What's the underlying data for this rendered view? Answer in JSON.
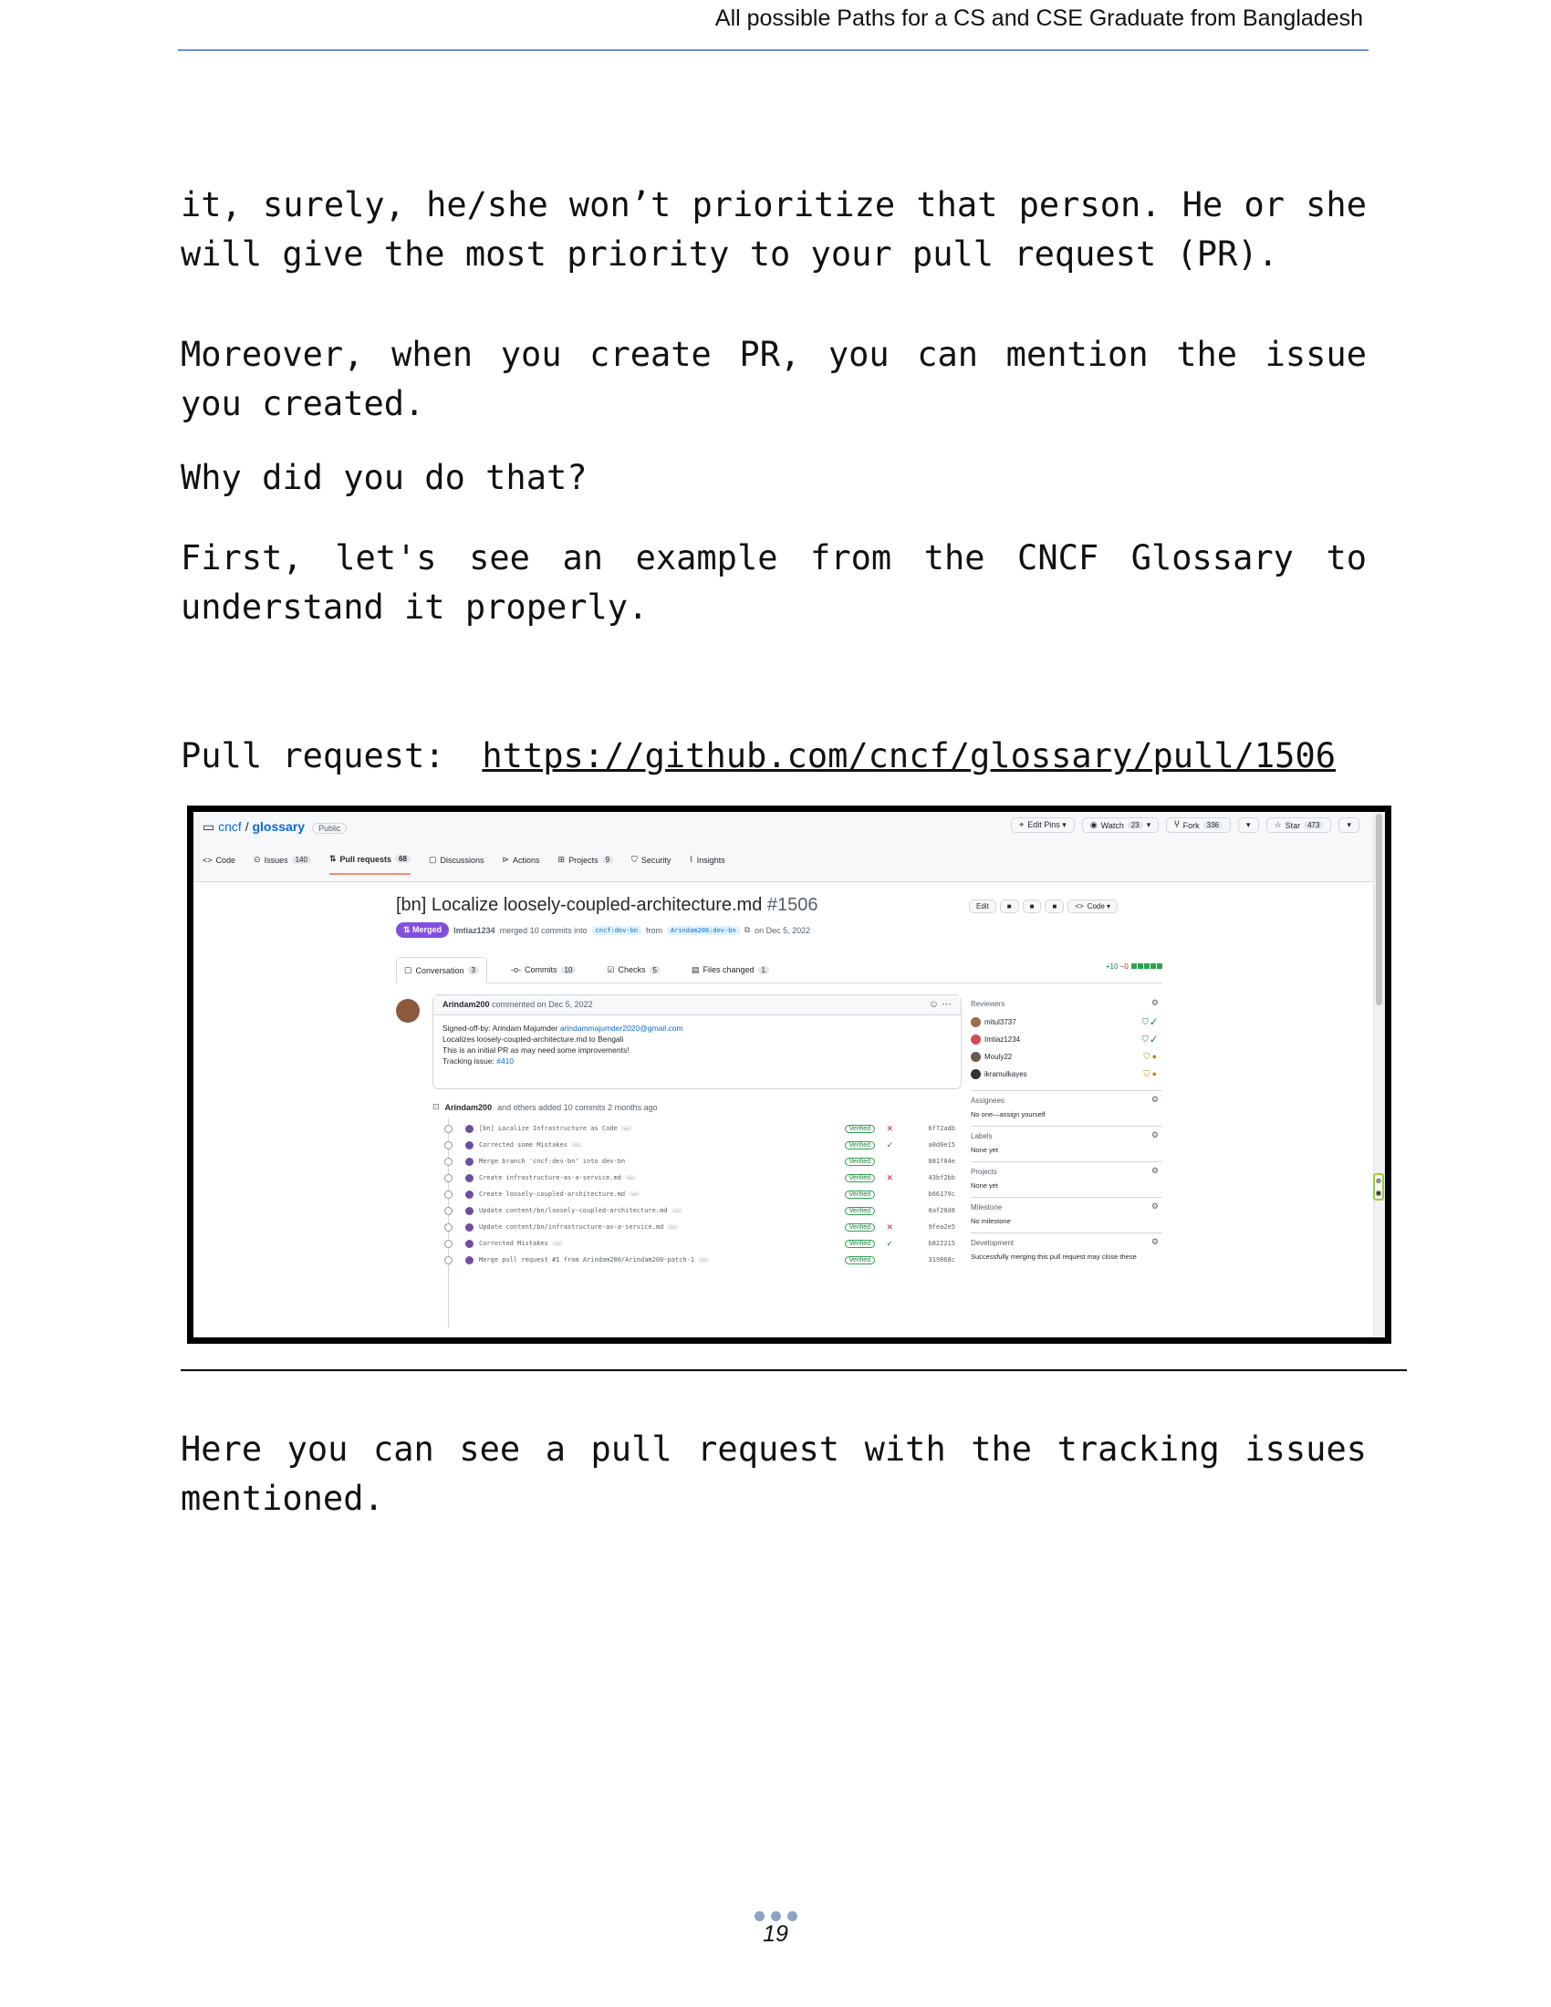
{
  "header": {
    "title": "All possible Paths for a CS and CSE Graduate from Bangladesh"
  },
  "paragraphs": {
    "p1": "it, surely, he/she won’t prioritize that person. He or she will give the most priority to your pull request (PR).",
    "p2": "Moreover, when you create PR, you can mention the issue you created.",
    "p3": "Why did you do that?",
    "p4": "First, let's see an example from the CNCF Glossary to understand it properly.",
    "p5": "Here you can see a pull request with the tracking issues mentioned."
  },
  "pr_line": {
    "label": "Pull request:",
    "link": "https://github.com/cncf/glossary/pull/1506"
  },
  "screenshot": {
    "repo_owner": "cncf",
    "repo_sep": "/",
    "repo_name": "glossary",
    "visibility": "Public",
    "top_buttons": [
      {
        "label": "Edit Pins ▾",
        "icon": "pin-icon"
      },
      {
        "label": "Watch",
        "count": "23",
        "icon": "eye-icon"
      },
      {
        "label": "Fork",
        "count": "336",
        "icon": "fork-icon"
      },
      {
        "label": "Star",
        "count": "473",
        "icon": "star-icon"
      }
    ],
    "nav": [
      {
        "label": "Code",
        "icon": "code-icon"
      },
      {
        "label": "Issues",
        "count": "140",
        "icon": "issue-icon"
      },
      {
        "label": "Pull requests",
        "count": "68",
        "icon": "pr-icon",
        "active": true
      },
      {
        "label": "Discussions",
        "icon": "discussion-icon"
      },
      {
        "label": "Actions",
        "icon": "actions-icon"
      },
      {
        "label": "Projects",
        "count": "9",
        "icon": "table-icon"
      },
      {
        "label": "Security",
        "icon": "shield-icon"
      },
      {
        "label": "Insights",
        "icon": "graph-icon"
      }
    ],
    "title": "[bn] Localize loosely-coupled-architecture.md",
    "number": "#1506",
    "status": "Merged",
    "merge_author": "Imtiaz1234",
    "merge_text": "merged 10 commits into",
    "base_branch": "cncf:dev-bn",
    "from_text": "from",
    "head_branch": "Arindam200:dev-bn",
    "merge_date": "on Dec 5, 2022",
    "header_buttons": [
      "Edit",
      "Code ▾"
    ],
    "tabs": [
      {
        "label": "Conversation",
        "count": "3",
        "active": true
      },
      {
        "label": "Commits",
        "count": "10"
      },
      {
        "label": "Checks",
        "count": "5"
      },
      {
        "label": "Files changed",
        "count": "1"
      }
    ],
    "diff_add": "+10",
    "diff_del": "−0",
    "comment": {
      "author": "Arindam200",
      "meta": "commented on Dec 5, 2022",
      "line1_prefix": "Signed-off-by: Arindam Majumder",
      "line1_email": "arindammajumder2020@gmail.com",
      "line2": "Localizes loosely-coupled-architecture.md to Bengali",
      "line3": "This is an initial PR as may need some improvements!",
      "line4_prefix": "Tracking issue:",
      "line4_link": "#410"
    },
    "commits_author": "Arindam200",
    "commits_meta": "and others added 10 commits 2 months ago",
    "commits": [
      {
        "msg": "[bn] Localize Infrastructure as Code",
        "ver": "Verified",
        "status": "x",
        "sha": "6f72adb"
      },
      {
        "msg": "Corrected some Mistakes",
        "ver": "Verified",
        "status": "ok",
        "sha": "a0d0e15"
      },
      {
        "msg": "Merge branch 'cncf:dev-bn' into dev-bn",
        "ver": "Verified",
        "status": "",
        "sha": "881f04e"
      },
      {
        "msg": "Create infrastructure-as-a-service.md",
        "ver": "Verified",
        "status": "x",
        "sha": "43bf2bb"
      },
      {
        "msg": "Create loosely-coupled-architecture.md",
        "ver": "Verified",
        "status": "",
        "sha": "b66179c"
      },
      {
        "msg": "Update content/bn/loosely-coupled-architecture.md",
        "ver": "Verified",
        "status": "",
        "sha": "0af20d8"
      },
      {
        "msg": "Update content/bn/infrastructure-as-a-service.md",
        "ver": "Verified",
        "status": "x",
        "sha": "9fea2e5"
      },
      {
        "msg": "Corrected Mistakes",
        "ver": "Verified",
        "status": "ok",
        "sha": "b822215"
      },
      {
        "msg": "Merge pull request #1 from Arindam200/Arindam200-patch-1",
        "ver": "Verified",
        "status": "",
        "sha": "319868c"
      }
    ],
    "sidebar": {
      "reviewers_label": "Reviewers",
      "reviewers": [
        {
          "name": "mitul3737",
          "state": "ok"
        },
        {
          "name": "Imtiaz1234",
          "state": "ok"
        },
        {
          "name": "Mouly22",
          "state": "pend"
        },
        {
          "name": "ikramulkayes",
          "state": "pend"
        }
      ],
      "assignees_label": "Assignees",
      "assignees_value": "No one—assign yourself",
      "labels_label": "Labels",
      "labels_value": "None yet",
      "projects_label": "Projects",
      "projects_value": "None yet",
      "milestone_label": "Milestone",
      "milestone_value": "No milestone",
      "development_label": "Development",
      "development_value": "Successfully merging this pull request may close these"
    }
  },
  "page_number": "19"
}
